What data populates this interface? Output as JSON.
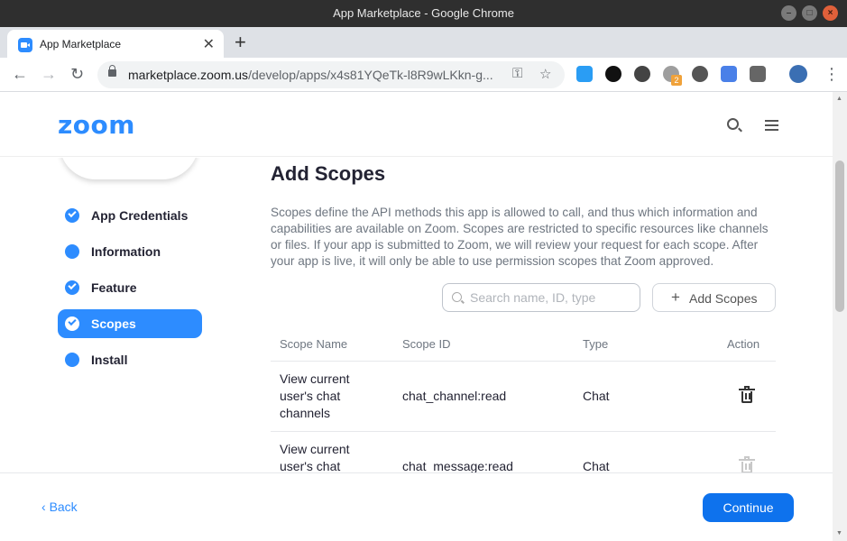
{
  "window": {
    "title": "App Marketplace - Google Chrome"
  },
  "browser": {
    "tab_title": "App Marketplace",
    "url_host": "marketplace.zoom.us",
    "url_path": "/develop/apps/x4s81YQeTk-l8R9wLKkn-g...",
    "extension_badge": "2"
  },
  "header": {
    "logo": "zoom"
  },
  "steps": [
    {
      "label": "App Credentials",
      "state": "done"
    },
    {
      "label": "Information",
      "state": "pending"
    },
    {
      "label": "Feature",
      "state": "done"
    },
    {
      "label": "Scopes",
      "state": "active"
    },
    {
      "label": "Install",
      "state": "pending"
    }
  ],
  "main": {
    "title": "Add Scopes",
    "description": "Scopes define the API methods this app is allowed to call, and thus which information and capabilities are available on Zoom. Scopes are restricted to specific resources like channels or files. If your app is submitted to Zoom, we will review your request for each scope. After your app is live, it will only be able to use permission scopes that Zoom approved.",
    "search_placeholder": "Search name, ID, type",
    "add_button": "Add Scopes"
  },
  "table": {
    "headers": {
      "name": "Scope Name",
      "id": "Scope ID",
      "type": "Type",
      "action": "Action"
    },
    "rows": [
      {
        "name": "View current user's chat channels",
        "id": "chat_channel:read",
        "type": "Chat"
      },
      {
        "name": "View current user's chat",
        "id": "chat_message:read",
        "type": "Chat"
      }
    ]
  },
  "footer": {
    "back": "Back",
    "continue": "Continue"
  },
  "colors": {
    "accent": "#2d8cff",
    "primary_button": "#0e72ed",
    "text": "#232333"
  }
}
